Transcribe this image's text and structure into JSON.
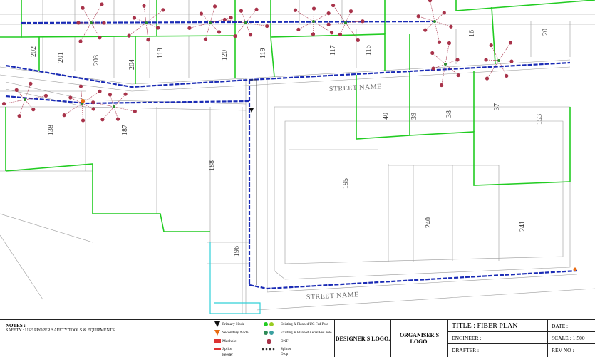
{
  "map": {
    "street_labels": [
      "STREET NAME",
      "STREET NAME"
    ],
    "lot_numbers": [
      "201",
      "203",
      "204",
      "202",
      "138",
      "187",
      "188",
      "195",
      "196",
      "240",
      "241",
      "40",
      "39",
      "38",
      "37",
      "153",
      "20",
      "16",
      "116",
      "117",
      "119",
      "120",
      "118"
    ]
  },
  "legend": {
    "primary_node": "Primary Node",
    "secondary_node": "Secondary Node",
    "manhole": "Manhole",
    "splice": "Splice",
    "splitter": "Splitter",
    "ont": "ONT",
    "ug_pole": "Existing & Planned UG Fed Pole",
    "aerial_pole": "Existing & Planned Aerial Fed Pole",
    "drop": "Drop",
    "feeder": "Feeder",
    "colors": {
      "feeder": "#1a2bb5",
      "boundary": "#22cc22",
      "ont": "#a8334a",
      "node": "#e86a10"
    }
  },
  "notes": {
    "heading": "NOTES :",
    "line": "SAFETY : USE PROPER SAFETY TOOLS & EQUIPMENTS"
  },
  "logos": {
    "designer": "DESIGNER'S LOGO.",
    "organiser": "ORGANISER'S LOGO."
  },
  "title_block": {
    "title": "TITLE : FIBER PLAN",
    "engineer": "ENGINEER :",
    "drafter": "DRAFTER :",
    "date": "DATE :",
    "scale": "SCALE : 1:500",
    "rev": "REV NO :"
  }
}
